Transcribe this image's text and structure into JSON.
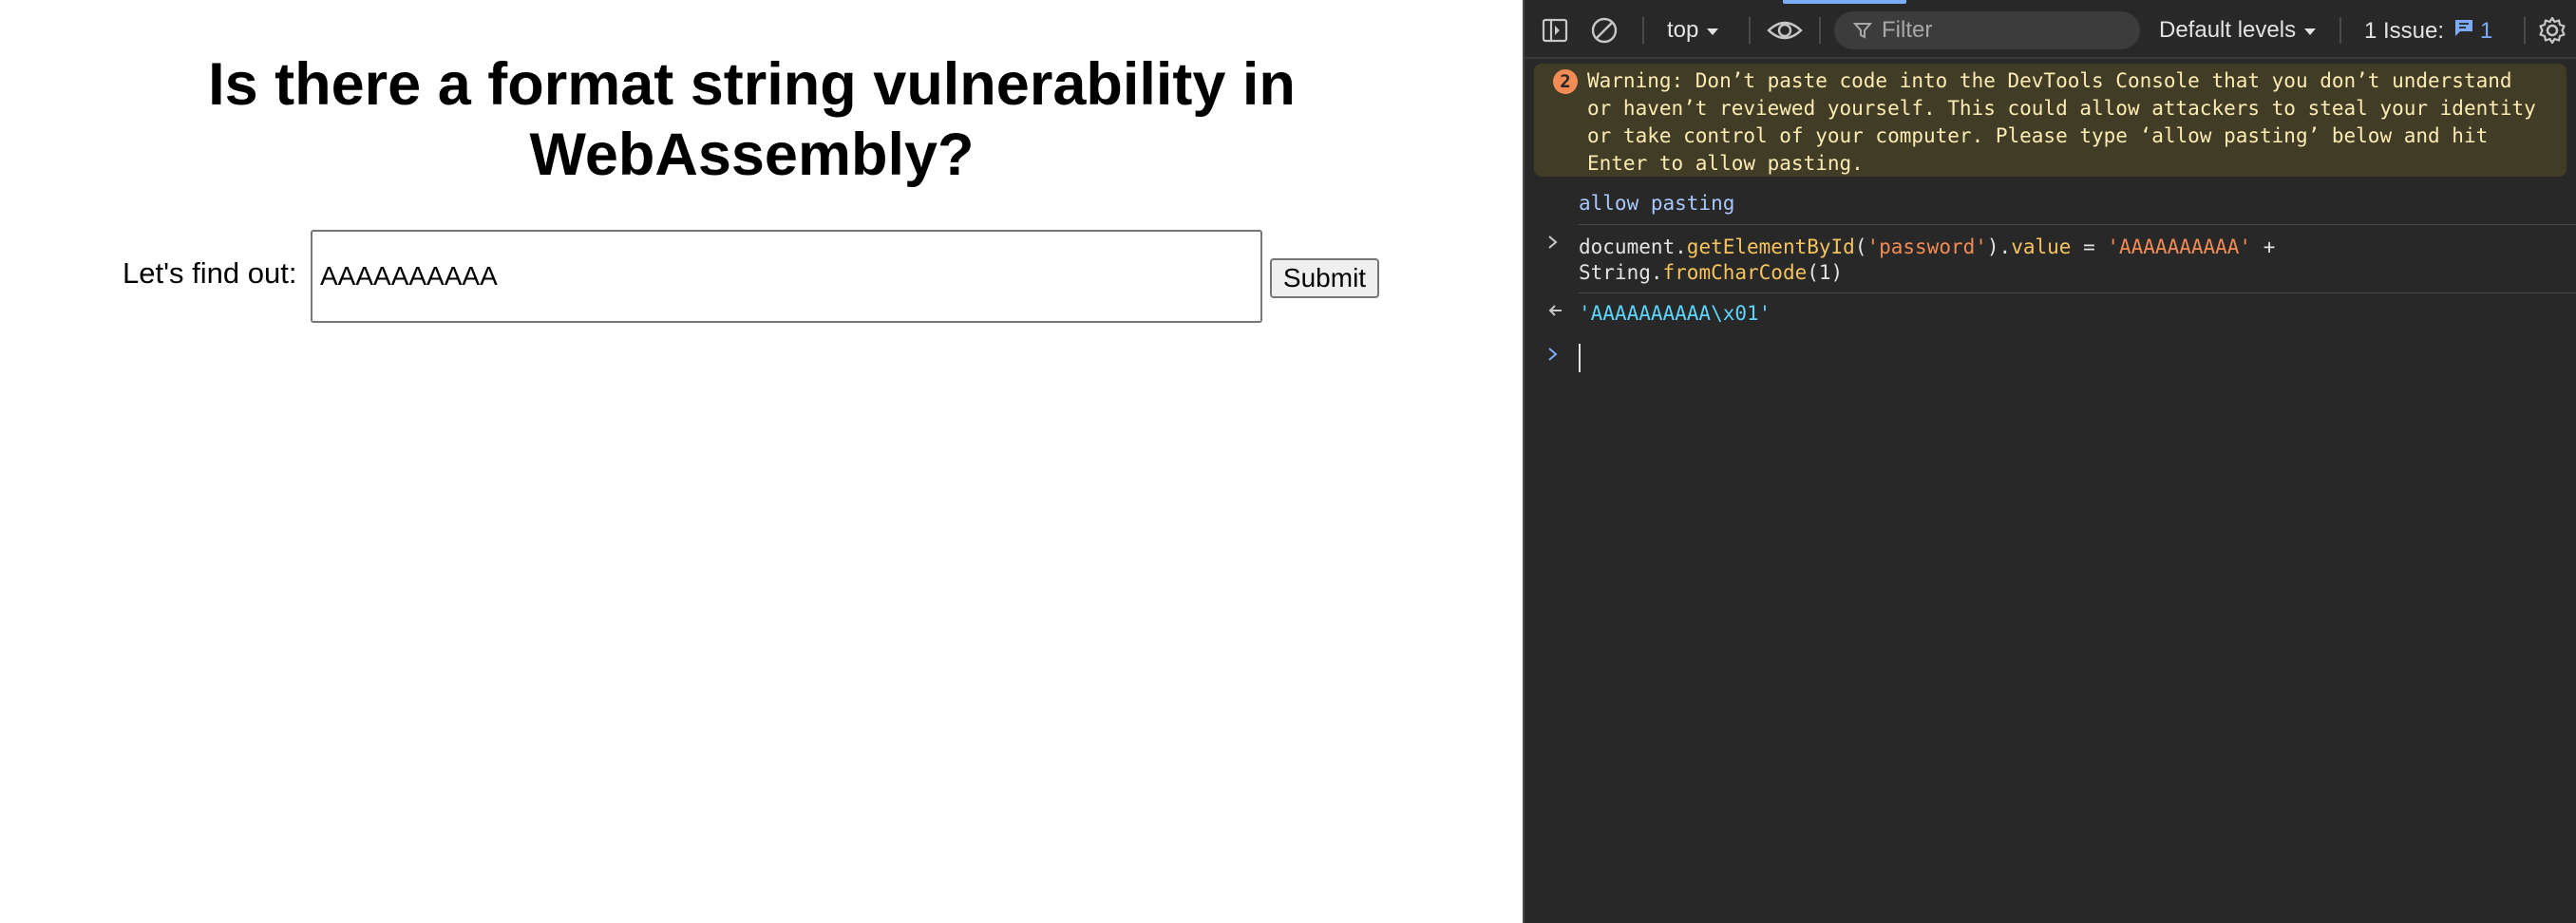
{
  "page": {
    "heading": "Is there a format string vulnerability in WebAssembly?",
    "label": "Let's find out:",
    "input_value": "AAAAAAAAAA\u0001",
    "submit_label": "Submit"
  },
  "devtools": {
    "toolbar": {
      "context": "top",
      "filter_placeholder": "Filter",
      "levels": "Default levels",
      "issues_label": "1 Issue:",
      "issues_count": "1",
      "icons": [
        "sidebar-toggle-icon",
        "clear-console-icon",
        "eye-icon",
        "filter-icon",
        "issue-icon",
        "settings-gear-icon"
      ]
    },
    "console": {
      "warning_count": "2",
      "warning_text": "Warning: Don’t paste code into the DevTools Console that you don’t understand or haven’t reviewed yourself. This could allow attackers to steal your identity or take control of your computer. Please type ‘allow pasting’ below and hit Enter to allow pasting.",
      "typed_line": "allow pasting",
      "command": {
        "p1": "document.",
        "p2": "getElementById",
        "p3": "(",
        "p4": "'password'",
        "p5": ").",
        "p6": "value",
        "p7": " = ",
        "p8": "'AAAAAAAAAA'",
        "p9": " +",
        "p10": "String.",
        "p11": "fromCharCode",
        "p12": "(1)"
      },
      "result": "'AAAAAAAAAA\\x01'"
    },
    "colors": {
      "background": "#282828",
      "warning_bg": "#413c26",
      "warning_text": "#fcebb3",
      "badge": "#f28b54",
      "string": "#f28b54",
      "function": "#f6c35d",
      "result": "#5cd5fb",
      "link": "#a8c7fa"
    }
  }
}
